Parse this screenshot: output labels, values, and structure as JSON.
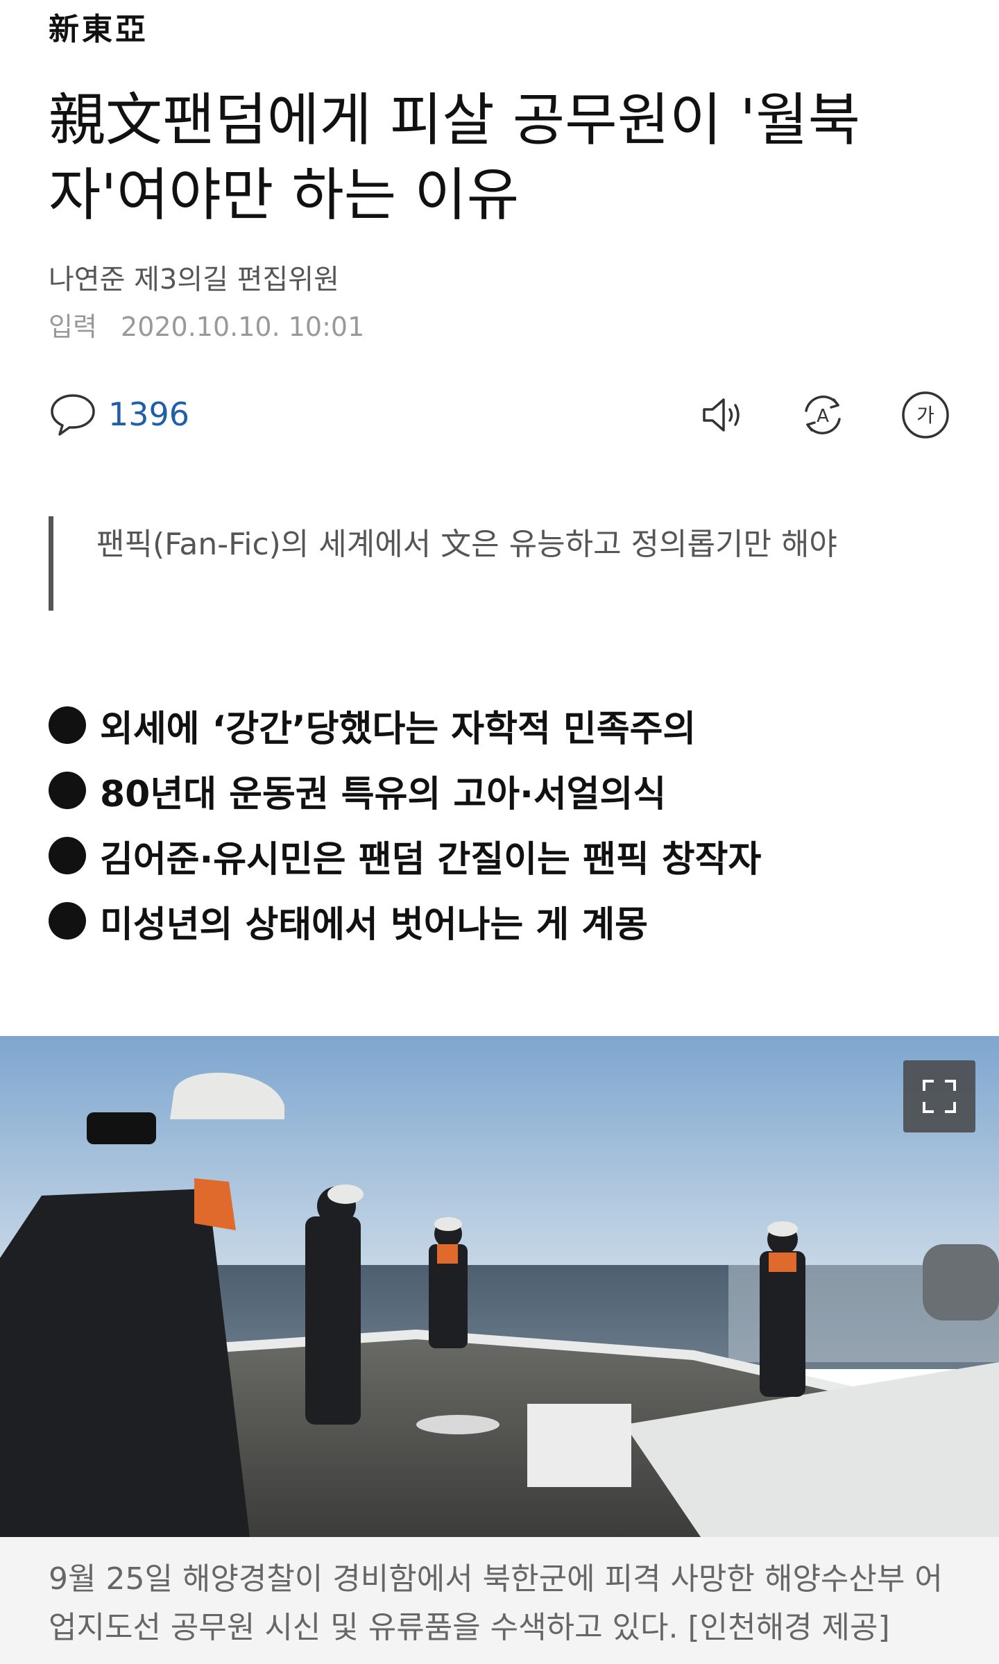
{
  "brand": {
    "logo_text": "新東亞"
  },
  "article": {
    "headline": "親文팬덤에게 피살 공무원이 '월북자'여야만 하는 이유",
    "author": "나연준 제3의길 편집위원",
    "date_label": "입력",
    "date_value": "2020.10.10. 10:01"
  },
  "actions": {
    "comment_count": "1396",
    "comment_icon": "speech-bubble-icon",
    "listen_icon": "speaker-icon",
    "translate_icon": "translate-icon",
    "fontsize_icon": "font-size-icon",
    "fontsize_glyph": "가",
    "translate_glyph": "A"
  },
  "summary": "팬픽(Fan-Fic)의 세계에서 文은 유능하고 정의롭기만 해야",
  "bullets": [
    "외세에 ‘강간’당했다는 자학적 민족주의",
    "80년대 운동권 특유의 고아·서얼의식",
    "김어준·유시민은 팬덤 간질이는 팬픽 창작자",
    "미성년의 상태에서 벗어나는 게 계몽"
  ],
  "photo": {
    "expand_icon": "fullscreen-icon",
    "caption": "9월 25일 해양경찰이 경비함에서 북한군에 피격 사망한 해양수산부 어업지도선 공무원 시신 및 유류품을 수색하고 있다. [인천해경 제공]"
  },
  "colors": {
    "accent": "#1f5ea8",
    "text": "#111111",
    "muted": "#999999",
    "caption_bg": "#f4f4f4"
  }
}
